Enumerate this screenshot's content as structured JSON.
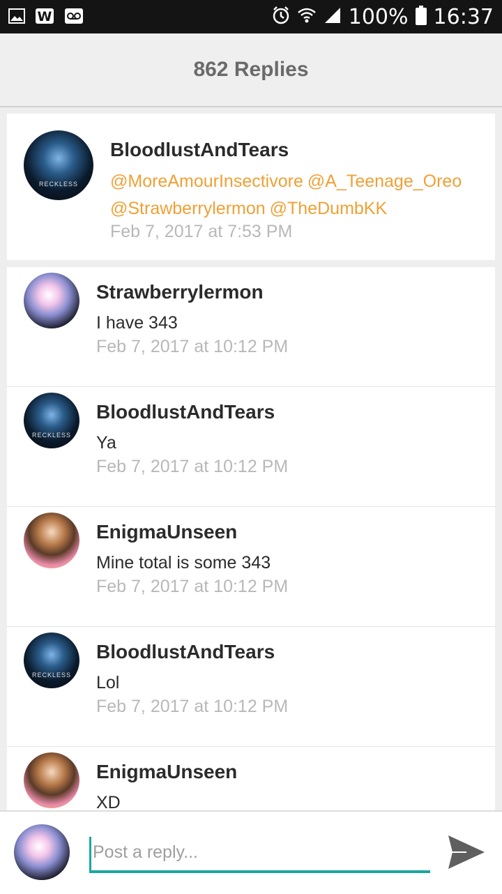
{
  "status_bar": {
    "battery": "100%",
    "time": "16:37",
    "left_icons": [
      "image-icon",
      "w-notification-icon",
      "voicemail-icon"
    ],
    "right_icons": [
      "alarm-icon",
      "wifi-icon",
      "signal-icon",
      "battery-icon"
    ]
  },
  "header": {
    "title": "862 Replies"
  },
  "original_post": {
    "avatar_icon": "user-avatar-bloodlust",
    "avatar_mark": "RECKLESS",
    "author": "BloodlustAndTears",
    "mentions": [
      "@MoreAmourInsectivore",
      "@A_Teenage_Oreo",
      "@Strawberrylermon",
      "@TheDumbKK"
    ],
    "timestamp": "Feb 7, 2017 at 7:53 PM"
  },
  "replies": [
    {
      "author": "Strawberrylermon",
      "text": "I have 343",
      "timestamp": "Feb 7, 2017 at 10:12 PM",
      "avatar": "sb"
    },
    {
      "author": "BloodlustAndTears",
      "text": "Ya",
      "timestamp": "Feb 7, 2017 at 10:12 PM",
      "avatar": "bt"
    },
    {
      "author": "EnigmaUnseen",
      "text": "Mine total is some 343",
      "timestamp": "Feb 7, 2017 at 10:12 PM",
      "avatar": "eu"
    },
    {
      "author": "BloodlustAndTears",
      "text": "Lol",
      "timestamp": "Feb 7, 2017 at 10:12 PM",
      "avatar": "bt"
    },
    {
      "author": "EnigmaUnseen",
      "text": "XD",
      "timestamp": "",
      "avatar": "eu"
    }
  ],
  "composer": {
    "placeholder": "Post a reply...",
    "value": "",
    "send_icon": "send-icon"
  },
  "colors": {
    "mention": "#f0a035",
    "accent": "#1aa7a0",
    "timestamp": "#b8b8b8",
    "status_bar": "#141414"
  }
}
